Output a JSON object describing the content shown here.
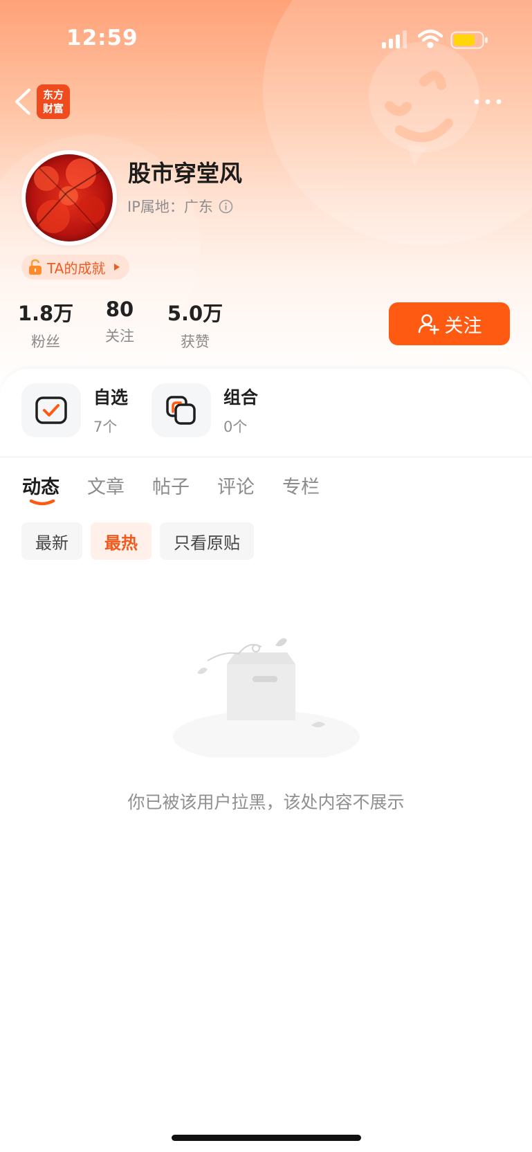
{
  "status_bar": {
    "time": "12:59"
  },
  "header": {
    "app_logo_line1": "东方",
    "app_logo_line2": "财富"
  },
  "profile": {
    "username": "股市穿堂风",
    "ip_location": "IP属地：广东",
    "achievement_label": "TA的成就"
  },
  "stats": [
    {
      "value": "1.8万",
      "label": "粉丝"
    },
    {
      "value": "80",
      "label": "关注"
    },
    {
      "value": "5.0万",
      "label": "获赞"
    }
  ],
  "follow_button": {
    "label": "关注"
  },
  "tools": [
    {
      "title": "自选",
      "count": "7个",
      "icon": "checkbox-icon"
    },
    {
      "title": "组合",
      "count": "0个",
      "icon": "overlapping-squares-icon"
    }
  ],
  "tabs": [
    {
      "label": "动态",
      "active": true
    },
    {
      "label": "文章",
      "active": false
    },
    {
      "label": "帖子",
      "active": false
    },
    {
      "label": "评论",
      "active": false
    },
    {
      "label": "专栏",
      "active": false
    }
  ],
  "filters": [
    {
      "label": "最新",
      "active": false
    },
    {
      "label": "最热",
      "active": true
    },
    {
      "label": "只看原贴",
      "active": false
    }
  ],
  "empty_state": {
    "message": "你已被该用户拉黑，该处内容不展示"
  },
  "colors": {
    "accent": "#ff5a11",
    "accent_text": "#f05a1e",
    "header_top": "#ffa278"
  }
}
